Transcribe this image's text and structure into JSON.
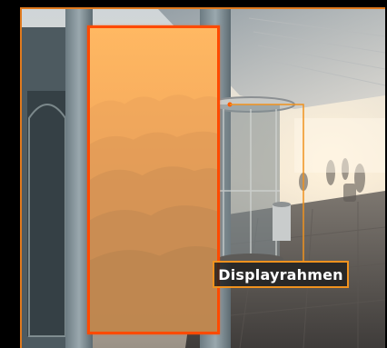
{
  "callout": {
    "label": "Displayrahmen"
  },
  "colors": {
    "frame_border": "#ff4a00",
    "leader_line": "#f0921e",
    "display_fill": "#f7ad5e"
  }
}
